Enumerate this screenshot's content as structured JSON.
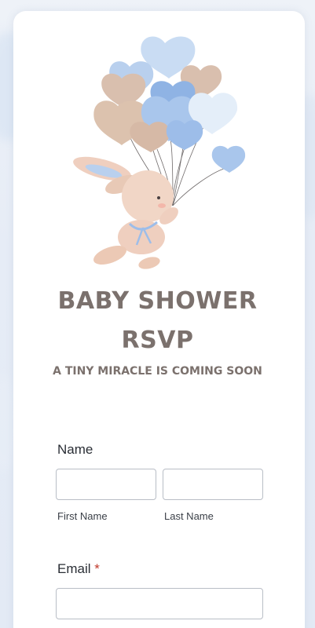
{
  "header": {
    "title_line1": "BABY SHOWER",
    "title_line2": "RSVP",
    "subtitle": "A TINY MIRACLE IS COMING SOON"
  },
  "form": {
    "name_label": "Name",
    "first_name_label": "First Name",
    "last_name_label": "Last Name",
    "first_name_value": "",
    "last_name_value": "",
    "email_label": "Email",
    "email_required_marker": "*",
    "email_value": ""
  },
  "colors": {
    "title": "#7b716d",
    "required": "#c0392b",
    "balloon_blue": "#a9c6ec",
    "balloon_beige": "#d9bfae"
  }
}
